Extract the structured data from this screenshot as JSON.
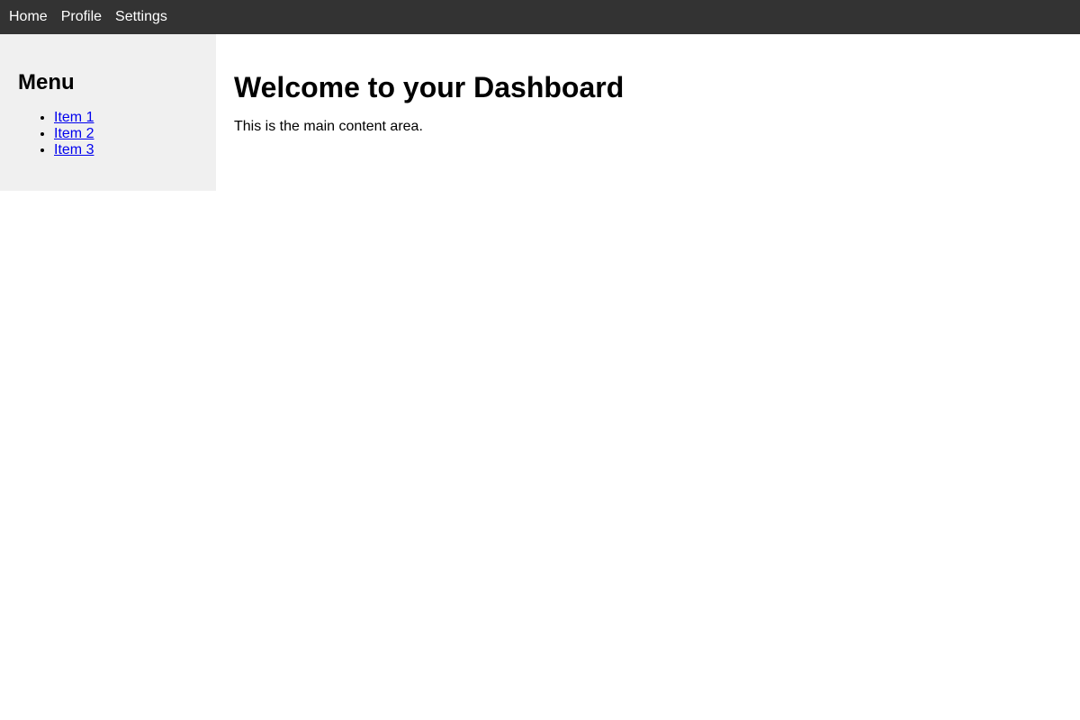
{
  "topnav": {
    "items": [
      {
        "label": "Home"
      },
      {
        "label": "Profile"
      },
      {
        "label": "Settings"
      }
    ]
  },
  "sidebar": {
    "title": "Menu",
    "items": [
      {
        "label": "Item 1"
      },
      {
        "label": "Item 2"
      },
      {
        "label": "Item 3"
      }
    ]
  },
  "main": {
    "title": "Welcome to your Dashboard",
    "body": "This is the main content area."
  },
  "colors": {
    "nav_background": "#333333",
    "sidebar_background": "#f0f0f0",
    "link": "#0000ee"
  }
}
